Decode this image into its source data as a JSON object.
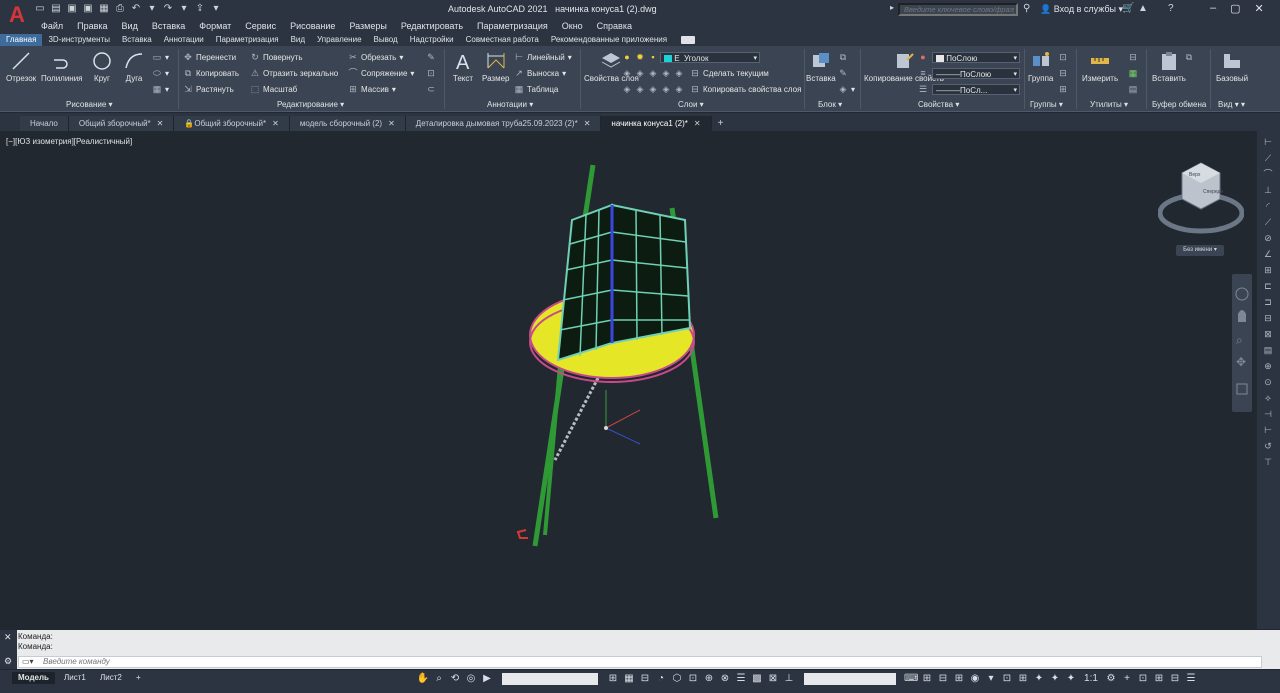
{
  "titlebar": {
    "app_title": "Autodesk AutoCAD 2021",
    "file_name": "начинка конуса1 (2).dwg",
    "search_placeholder": "Введите ключевое слово/фразу",
    "signin": "Вход в службы",
    "menu": [
      "Файл",
      "Правка",
      "Вид",
      "Вставка",
      "Формат",
      "Сервис",
      "Рисование",
      "Размеры",
      "Редактировать",
      "Параметризация",
      "Окно",
      "Справка"
    ]
  },
  "ribbon_tabs": [
    "Главная",
    "3D-инструменты",
    "Вставка",
    "Аннотации",
    "Параметризация",
    "Вид",
    "Управление",
    "Вывод",
    "Надстройки",
    "Совместная работа",
    "Рекомендованные приложения"
  ],
  "ribbon": {
    "draw": {
      "title": "Рисование",
      "line": "Отрезок",
      "polyline": "Полилиния",
      "circle": "Круг",
      "arc": "Дуга"
    },
    "modify": {
      "title": "Редактирование",
      "move": "Перенести",
      "rotate": "Повернуть",
      "trim": "Обрезать",
      "copy": "Копировать",
      "mirror": "Отразить зеркально",
      "fillet": "Сопряжение",
      "stretch": "Растянуть",
      "scale": "Масштаб",
      "array": "Массив"
    },
    "annotation": {
      "title": "Аннотации",
      "text": "Текст",
      "dimension": "Размер",
      "linear": "Линейный",
      "leader": "Выноска",
      "table": "Таблица"
    },
    "layers": {
      "title": "Слои",
      "layer_props": "Свойства слоя",
      "current_layer": "Е_Уголок",
      "make_current": "Сделать текущим",
      "match_layer": "Копировать свойства слоя"
    },
    "block": {
      "title": "Блок",
      "insert": "Вставка"
    },
    "properties": {
      "title": "Свойства",
      "match": "Копирование свойств",
      "color": "ПоСлою",
      "linetype": "ПоСлою",
      "lineweight": "ПоСл..."
    },
    "groups": {
      "title": "Группы",
      "group": "Группа"
    },
    "utilities": {
      "title": "Утилиты",
      "measure": "Измерить"
    },
    "clipboard": {
      "title": "Буфер обмена",
      "paste": "Вставить"
    },
    "view": {
      "title": "Вид",
      "base": "Базовый"
    }
  },
  "doc_tabs": [
    {
      "label": "Начало",
      "active": false
    },
    {
      "label": "Общий зборочный*",
      "active": false
    },
    {
      "label": "Общий зборочный*",
      "active": false
    },
    {
      "label": "модель сборочный (2)",
      "active": false
    },
    {
      "label": "Деталировка дымовая труба25.09.2023 (2)*",
      "active": false
    },
    {
      "label": "начинка конуса1 (2)*",
      "active": true
    }
  ],
  "viewport": {
    "label": "[−][ЮЗ изометрия][Реалистичный]",
    "ucs_button": "Без имени",
    "viewcube_face_top": "Верх",
    "viewcube_face_right": "Спереди"
  },
  "command": {
    "history": [
      "Команда:",
      "Команда:"
    ],
    "placeholder": "Введите команду"
  },
  "status": {
    "layouts": [
      "Модель",
      "Лист1",
      "Лист2"
    ],
    "scale": "1:1"
  },
  "colors": {
    "accent": "#3c6b9c",
    "viewport_bg": "#212830",
    "ribbon_bg": "#3a4452",
    "layer_color": "#19d3d8"
  }
}
